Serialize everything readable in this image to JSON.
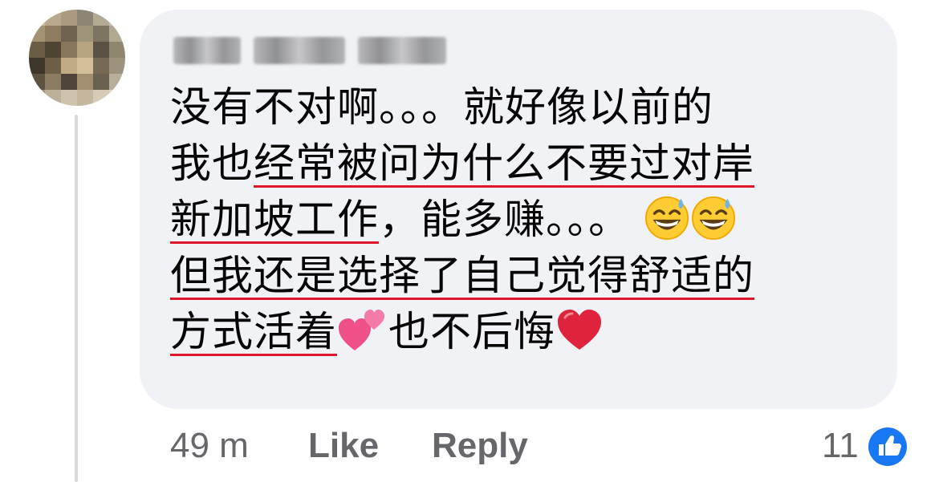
{
  "comment": {
    "lines": [
      {
        "before": "没有不对啊。。。就好像以前的",
        "underlined": "",
        "after": ""
      },
      {
        "before": "我也",
        "underlined": "经常被问为什么不要过对岸",
        "after": ""
      },
      {
        "before": "",
        "underlined": "新加坡工作",
        "after": "，能多赚。。。"
      },
      {
        "before": "",
        "underlined": "但我还是选择了自己觉得舒适的",
        "after": ""
      },
      {
        "before": "",
        "underlined": "方式活着",
        "after": "也不后悔"
      }
    ],
    "emojis": [
      "grinning-sweat-emoji",
      "grinning-sweat-emoji",
      "two-hearts-emoji",
      "red-heart-emoji"
    ],
    "underline_color": "#e0162b"
  },
  "footer": {
    "timestamp": "49 m",
    "like_label": "Like",
    "reply_label": "Reply",
    "reaction_count": "11",
    "reaction_icon": "like-reaction-icon"
  },
  "colors": {
    "bubble": "#f0f2f5",
    "secondary_text": "#65676b",
    "like_blue": "#1877f2"
  }
}
